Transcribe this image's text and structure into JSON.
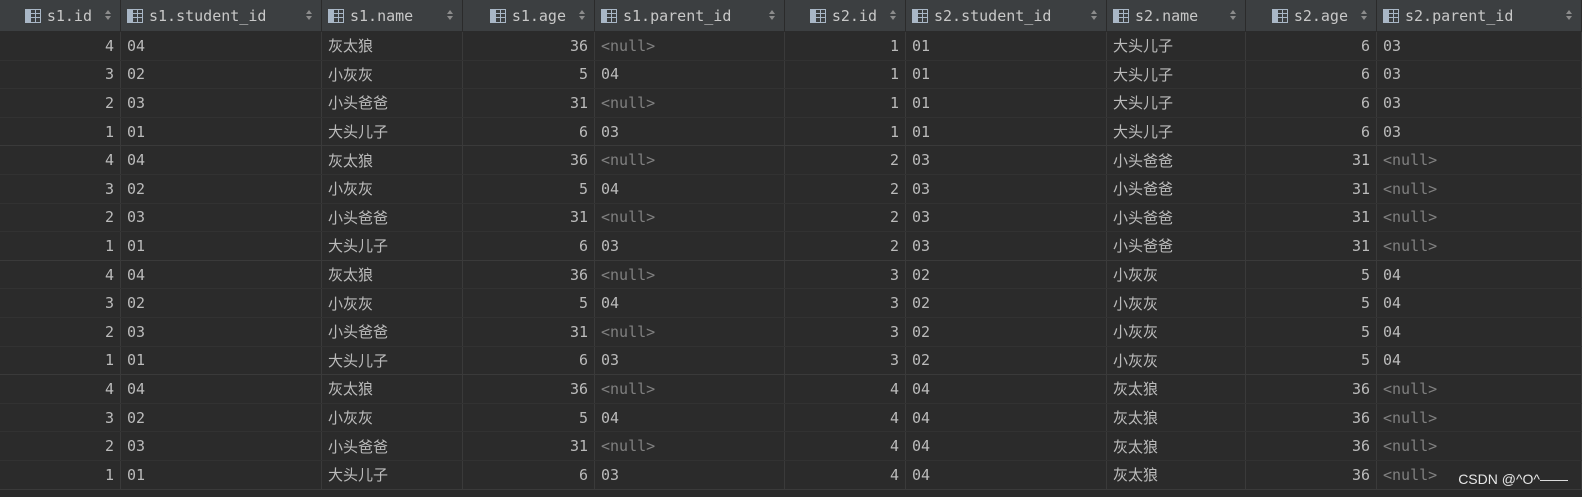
{
  "columns": [
    {
      "label": "s1.id",
      "align": "right"
    },
    {
      "label": "s1.student_id",
      "align": "left"
    },
    {
      "label": "s1.name",
      "align": "left"
    },
    {
      "label": "s1.age",
      "align": "right"
    },
    {
      "label": "s1.parent_id",
      "align": "left"
    },
    {
      "label": "s2.id",
      "align": "right"
    },
    {
      "label": "s2.student_id",
      "align": "left"
    },
    {
      "label": "s2.name",
      "align": "left"
    },
    {
      "label": "s2.age",
      "align": "right"
    },
    {
      "label": "s2.parent_id",
      "align": "left"
    }
  ],
  "rows": [
    [
      "4",
      "04",
      "灰太狼",
      "36",
      "<null>",
      "1",
      "01",
      "大头儿子",
      "6",
      "03"
    ],
    [
      "3",
      "02",
      "小灰灰",
      "5",
      "04",
      "1",
      "01",
      "大头儿子",
      "6",
      "03"
    ],
    [
      "2",
      "03",
      "小头爸爸",
      "31",
      "<null>",
      "1",
      "01",
      "大头儿子",
      "6",
      "03"
    ],
    [
      "1",
      "01",
      "大头儿子",
      "6",
      "03",
      "1",
      "01",
      "大头儿子",
      "6",
      "03"
    ],
    [
      "4",
      "04",
      "灰太狼",
      "36",
      "<null>",
      "2",
      "03",
      "小头爸爸",
      "31",
      "<null>"
    ],
    [
      "3",
      "02",
      "小灰灰",
      "5",
      "04",
      "2",
      "03",
      "小头爸爸",
      "31",
      "<null>"
    ],
    [
      "2",
      "03",
      "小头爸爸",
      "31",
      "<null>",
      "2",
      "03",
      "小头爸爸",
      "31",
      "<null>"
    ],
    [
      "1",
      "01",
      "大头儿子",
      "6",
      "03",
      "2",
      "03",
      "小头爸爸",
      "31",
      "<null>"
    ],
    [
      "4",
      "04",
      "灰太狼",
      "36",
      "<null>",
      "3",
      "02",
      "小灰灰",
      "5",
      "04"
    ],
    [
      "3",
      "02",
      "小灰灰",
      "5",
      "04",
      "3",
      "02",
      "小灰灰",
      "5",
      "04"
    ],
    [
      "2",
      "03",
      "小头爸爸",
      "31",
      "<null>",
      "3",
      "02",
      "小灰灰",
      "5",
      "04"
    ],
    [
      "1",
      "01",
      "大头儿子",
      "6",
      "03",
      "3",
      "02",
      "小灰灰",
      "5",
      "04"
    ],
    [
      "4",
      "04",
      "灰太狼",
      "36",
      "<null>",
      "4",
      "04",
      "灰太狼",
      "36",
      "<null>"
    ],
    [
      "3",
      "02",
      "小灰灰",
      "5",
      "04",
      "4",
      "04",
      "灰太狼",
      "36",
      "<null>"
    ],
    [
      "2",
      "03",
      "小头爸爸",
      "31",
      "<null>",
      "4",
      "04",
      "灰太狼",
      "36",
      "<null>"
    ],
    [
      "1",
      "01",
      "大头儿子",
      "6",
      "03",
      "4",
      "04",
      "灰太狼",
      "36",
      "<null>"
    ]
  ],
  "watermark": "CSDN @^O^——",
  "icons": {
    "column_header": "table-column-icon",
    "sort": "sort-arrows-icon"
  },
  "colors": {
    "background": "#2b2b2b",
    "header": "#3c3f41",
    "text": "#bbbbbb",
    "null_text": "#808080"
  }
}
